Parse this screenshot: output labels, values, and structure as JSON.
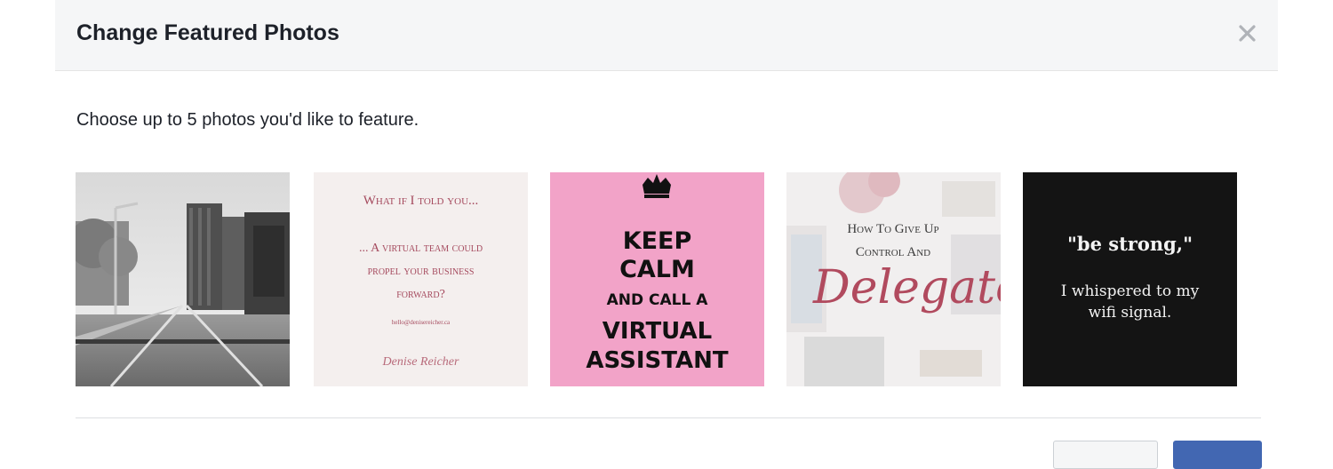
{
  "dialog": {
    "title": "Change Featured Photos",
    "close_icon": "close-icon",
    "instructions": "Choose up to 5 photos you'd like to feature."
  },
  "photos": [
    {
      "name": "street-photo",
      "text_lines": []
    },
    {
      "name": "virtual-team-photo",
      "text_lines": [
        "What if I told you...",
        "... A virtual team could",
        "propel your business",
        "forward?",
        "hello@denisereicher.ca"
      ],
      "signature": "Denise Reicher"
    },
    {
      "name": "keep-calm-photo",
      "text_lines": [
        "KEEP",
        "CALM",
        "AND CALL A",
        "VIRTUAL",
        "ASSISTANT"
      ],
      "icon": "crown-icon"
    },
    {
      "name": "delegate-photo",
      "text_lines": [
        "How To Give Up",
        "Control And",
        "Delegate"
      ]
    },
    {
      "name": "be-strong-photo",
      "text_lines": [
        "\"be strong,\"",
        "I whispered to my",
        "wifi signal."
      ]
    }
  ],
  "colors": {
    "header_bg": "#f5f6f7",
    "title": "#1d2129",
    "keep_calm_bg": "#f2a3c8",
    "be_strong_bg": "#141414",
    "accent_rose": "#a54a5e"
  }
}
